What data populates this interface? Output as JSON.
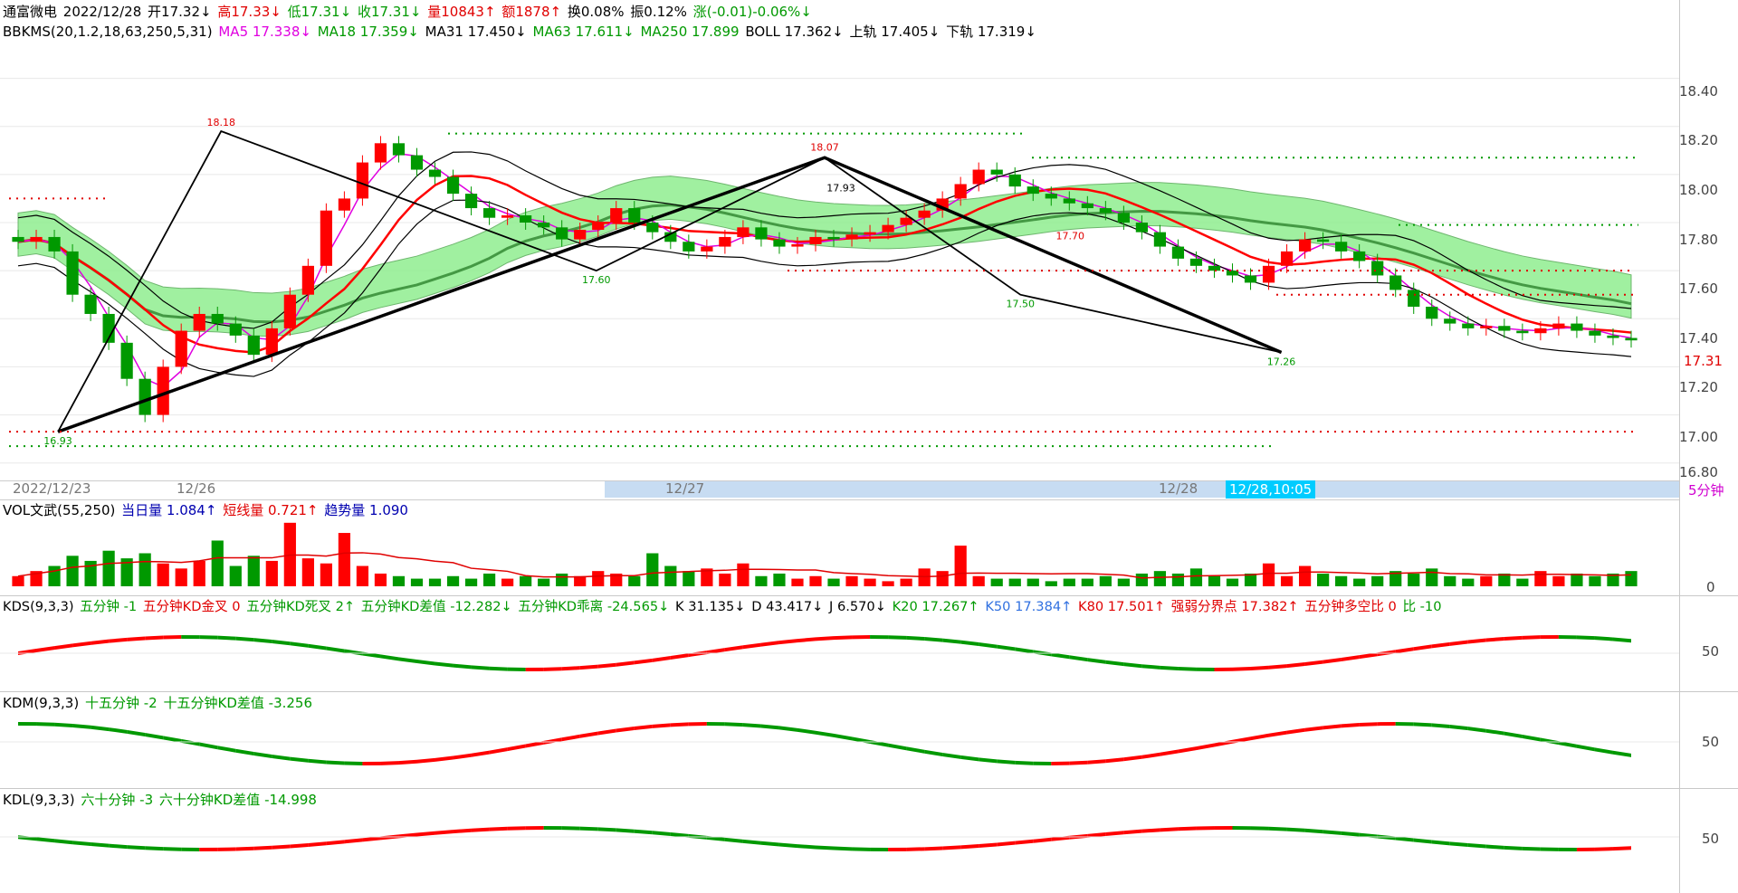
{
  "header": {
    "name": "通富微电",
    "date": "2022/12/28",
    "open": "开17.32↓",
    "high": "高17.33↓",
    "low": "低17.31↓",
    "close": "收17.31↓",
    "volume": "量10843↑",
    "amount": "额1878↑",
    "turnover": "换0.08%",
    "amplitude": "振0.12%",
    "change": "涨(-0.01)-0.06%↓"
  },
  "main_indicator": {
    "name": "BBKMS(20,1.2,18,63,250,5,31)",
    "ma5": "MA5 17.338↓",
    "ma18": "MA18 17.359↓",
    "ma31": "MA31 17.450↓",
    "ma63": "MA63 17.611↓",
    "ma250": "MA250 17.899",
    "boll": "BOLL 17.362↓",
    "upper": "上轨 17.405↓",
    "lower": "下轨 17.319↓"
  },
  "vol_indicator": {
    "name": "VOL文武(55,250)",
    "today": "当日量 1.084↑",
    "short": "短线量 0.721↑",
    "trend": "趋势量 1.090"
  },
  "kds_indicator": {
    "name": "KDS(9,3,3)",
    "p1": "五分钟 -1",
    "p2": "五分钟KD金叉 0",
    "p3": "五分钟KD死叉 2↑",
    "p4": "五分钟KD差值 -12.282↓",
    "p5": "五分钟KD乖离 -24.565↓",
    "k": "K 31.135↓",
    "d": "D 43.417↓",
    "j": "J 6.570↓",
    "k20": "K20 17.267↑",
    "k50": "K50 17.384↑",
    "k80": "K80 17.501↑",
    "strong": "强弱分界点 17.382↑",
    "ratio": "五分钟多空比 0",
    "bi": "比 -10"
  },
  "kdm_indicator": {
    "name": "KDM(9,3,3)",
    "p1": "十五分钟 -2",
    "p2": "十五分钟KD差值 -3.256"
  },
  "kdl_indicator": {
    "name": "KDL(9,3,3)",
    "p1": "六十分钟 -3",
    "p2": "六十分钟KD差值 -14.998"
  },
  "axis": {
    "price_ticks": [
      "18.40",
      "18.20",
      "18.00",
      "17.80",
      "17.60",
      "17.40",
      "17.20",
      "17.00",
      "16.80"
    ],
    "current_price": "17.31",
    "vol_tick": "0",
    "kds_tick": "50",
    "kdm_tick": "50",
    "kdl_tick": "50",
    "period": "5分钟",
    "dates": [
      "2022/12/23",
      "12/26",
      "12/27",
      "12/28"
    ],
    "cursor": "12/28,10:05"
  },
  "chart_data": {
    "type": "candlestick",
    "ylim": [
      16.75,
      18.5
    ],
    "annotations": [
      "18.18",
      "16.93",
      "18.07",
      "17.93",
      "17.60",
      "17.50",
      "17.70",
      "17.26"
    ],
    "zigzag": [
      18.18,
      16.93,
      18.07,
      17.6,
      17.5,
      17.26
    ],
    "closes": [
      17.72,
      17.74,
      17.68,
      17.5,
      17.42,
      17.3,
      17.15,
      17.0,
      17.2,
      17.35,
      17.42,
      17.38,
      17.33,
      17.25,
      17.36,
      17.5,
      17.62,
      17.85,
      17.9,
      18.05,
      18.13,
      18.08,
      18.02,
      17.99,
      17.92,
      17.86,
      17.82,
      17.83,
      17.8,
      17.78,
      17.73,
      17.77,
      17.8,
      17.86,
      17.8,
      17.76,
      17.72,
      17.68,
      17.7,
      17.74,
      17.78,
      17.73,
      17.7,
      17.71,
      17.74,
      17.73,
      17.75,
      17.76,
      17.79,
      17.82,
      17.85,
      17.9,
      17.96,
      18.02,
      18.0,
      17.95,
      17.92,
      17.9,
      17.88,
      17.86,
      17.84,
      17.8,
      17.76,
      17.7,
      17.65,
      17.62,
      17.6,
      17.58,
      17.55,
      17.62,
      17.68,
      17.73,
      17.72,
      17.68,
      17.64,
      17.58,
      17.52,
      17.45,
      17.4,
      17.38,
      17.36,
      17.37,
      17.35,
      17.34,
      17.36,
      17.38,
      17.35,
      17.33,
      17.32,
      17.31
    ],
    "volumes": [
      0.4,
      0.6,
      0.8,
      1.2,
      1.0,
      1.4,
      1.1,
      1.3,
      0.9,
      0.7,
      1.0,
      1.8,
      0.8,
      1.2,
      1.0,
      2.5,
      1.1,
      0.9,
      2.1,
      0.8,
      0.5,
      0.4,
      0.3,
      0.3,
      0.4,
      0.3,
      0.5,
      0.3,
      0.4,
      0.3,
      0.5,
      0.4,
      0.6,
      0.5,
      0.4,
      1.3,
      0.8,
      0.6,
      0.7,
      0.5,
      0.9,
      0.4,
      0.5,
      0.3,
      0.4,
      0.3,
      0.4,
      0.3,
      0.2,
      0.3,
      0.7,
      0.6,
      1.6,
      0.4,
      0.3,
      0.3,
      0.3,
      0.2,
      0.3,
      0.3,
      0.4,
      0.3,
      0.5,
      0.6,
      0.5,
      0.7,
      0.4,
      0.3,
      0.5,
      0.9,
      0.4,
      0.8,
      0.5,
      0.4,
      0.3,
      0.4,
      0.6,
      0.5,
      0.7,
      0.4,
      0.3,
      0.4,
      0.5,
      0.3,
      0.6,
      0.4,
      0.5,
      0.4,
      0.5,
      0.6
    ]
  },
  "colors": {
    "up": "#ff0000",
    "down": "#009900",
    "band": "#90ee90",
    "cloud": "#aee8ee"
  }
}
